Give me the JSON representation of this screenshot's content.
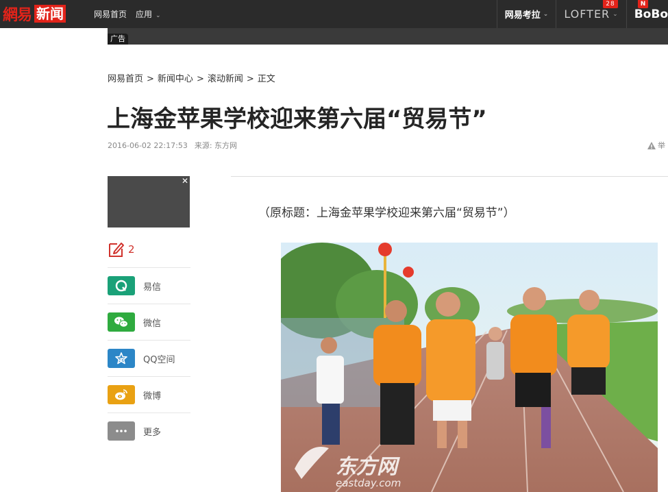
{
  "topbar": {
    "logo_163": "網易",
    "logo_news": "新闻",
    "nav": [
      {
        "label": "网易首页"
      },
      {
        "label": "应用"
      }
    ],
    "right": {
      "kaola": "网易考拉",
      "lofter": "LOFTER",
      "lofter_badge": "28",
      "bobo": "BoBo",
      "bobo_badge": "N"
    }
  },
  "ad": {
    "label": "广告"
  },
  "breadcrumb": [
    "网易首页",
    "新闻中心",
    "滚动新闻",
    "正文"
  ],
  "breadcrumb_sep": ">",
  "article": {
    "title": "上海金苹果学校迎来第六届“贸易节”",
    "datetime": "2016-06-02 22:17:53",
    "source": "来源: 东方网",
    "report_label": "举",
    "lead": "（原标题：上海金苹果学校迎来第六届“贸易节”）",
    "photo_watermark": "东方网",
    "photo_watermark_url": "eastday.com"
  },
  "sidebar": {
    "comment_count": "2",
    "share": [
      {
        "label": "易信",
        "icon": "yixin-icon",
        "color": "#1aa178"
      },
      {
        "label": "微信",
        "icon": "wechat-icon",
        "color": "#2fab3f"
      },
      {
        "label": "QQ空间",
        "icon": "qzone-icon",
        "color": "#2c86c7"
      },
      {
        "label": "微博",
        "icon": "weibo-icon",
        "color": "#e9a113"
      },
      {
        "label": "更多",
        "icon": "more-icon",
        "color": "#8c8c8c"
      }
    ]
  }
}
